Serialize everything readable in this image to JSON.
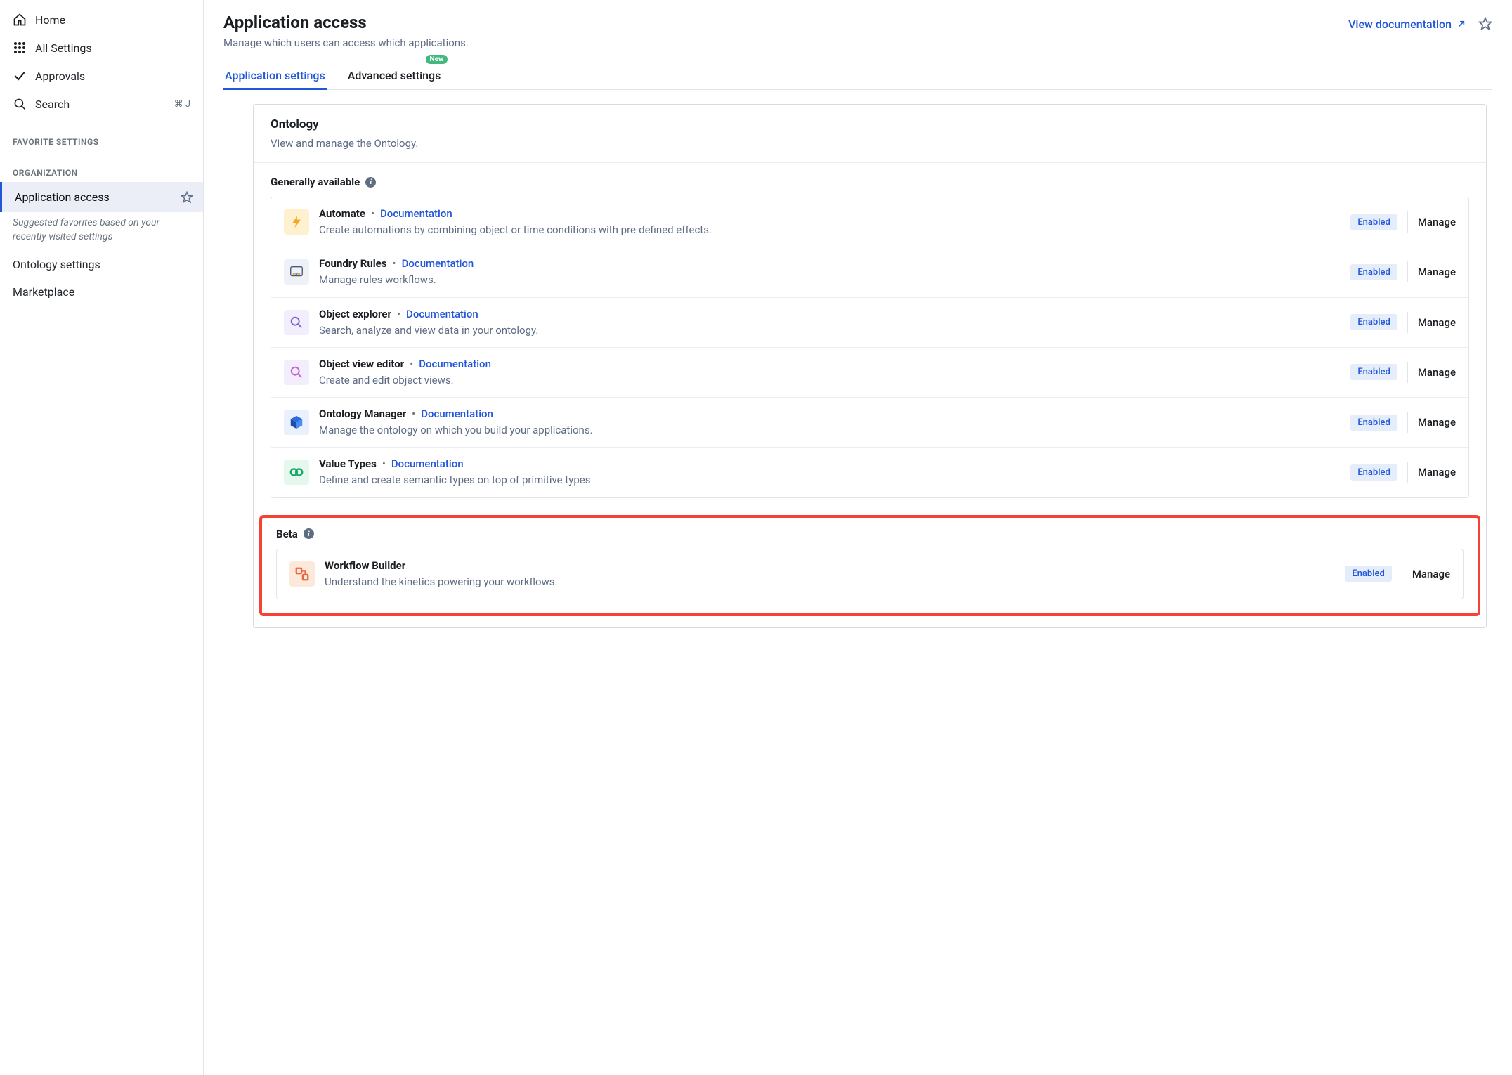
{
  "sidebar": {
    "nav": [
      {
        "label": "Home"
      },
      {
        "label": "All Settings"
      },
      {
        "label": "Approvals"
      },
      {
        "label": "Search",
        "shortcut": "⌘ J"
      }
    ],
    "favorite_header": "Favorite Settings",
    "org_header": "Organization",
    "selected": "Application access",
    "hint": "Suggested favorites based on your recently visited settings",
    "suggested": [
      "Ontology settings",
      "Marketplace"
    ]
  },
  "header": {
    "title": "Application access",
    "subtitle": "Manage which users can access which applications.",
    "doc_link": "View documentation"
  },
  "tabs": [
    {
      "label": "Application settings",
      "active": true,
      "badge": null
    },
    {
      "label": "Advanced settings",
      "active": false,
      "badge": "New"
    }
  ],
  "card": {
    "section_name": "Ontology",
    "section_desc": "View and manage the Ontology.",
    "ga_title": "Generally available",
    "beta_title": "Beta",
    "doc_label": "Documentation",
    "status_label": "Enabled",
    "manage_label": "Manage",
    "apps": [
      {
        "name": "Automate",
        "desc": "Create automations by combining object or time conditions with pre-defined effects."
      },
      {
        "name": "Foundry Rules",
        "desc": "Manage rules workflows."
      },
      {
        "name": "Object explorer",
        "desc": "Search, analyze and view data in your ontology."
      },
      {
        "name": "Object view editor",
        "desc": "Create and edit object views."
      },
      {
        "name": "Ontology Manager",
        "desc": "Manage the ontology on which you build your applications."
      },
      {
        "name": "Value Types",
        "desc": "Define and create semantic types on top of primitive types"
      }
    ],
    "beta_apps": [
      {
        "name": "Workflow Builder",
        "desc": "Understand the kinetics powering your workflows."
      }
    ]
  }
}
